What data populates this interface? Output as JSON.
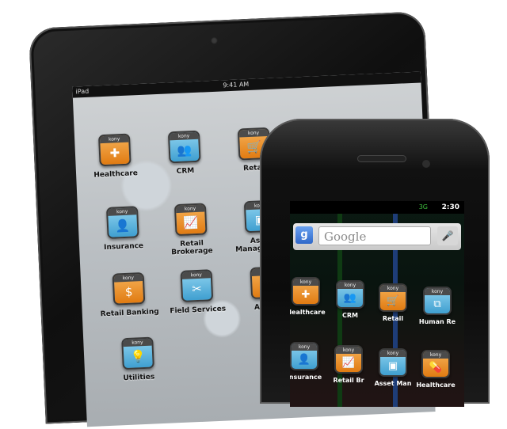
{
  "tablet": {
    "status": {
      "carrier": "iPad",
      "time": "9:41 AM"
    },
    "apps": [
      {
        "label": "Healthcare",
        "color": "orange",
        "icon": "shield-plus-icon",
        "glyph": "✚"
      },
      {
        "label": "CRM",
        "color": "blue",
        "icon": "people-icon",
        "glyph": "👥"
      },
      {
        "label": "Retail",
        "color": "orange",
        "icon": "cart-icon",
        "glyph": "🛒"
      },
      {
        "label": "Insurance",
        "color": "blue",
        "icon": "person-icon",
        "glyph": "👤"
      },
      {
        "label": "Retail Brokerage",
        "color": "orange",
        "icon": "chart-icon",
        "glyph": "📈"
      },
      {
        "label": "Asset Management",
        "color": "blue",
        "icon": "asset-icon",
        "glyph": "▣"
      },
      {
        "label": "Retail Banking",
        "color": "orange",
        "icon": "money-icon",
        "glyph": "$"
      },
      {
        "label": "Field Services",
        "color": "blue",
        "icon": "tools-icon",
        "glyph": "✂"
      },
      {
        "label": "Airline",
        "color": "orange",
        "icon": "plane-icon",
        "glyph": "✈"
      },
      {
        "label": "Utilities",
        "color": "blue",
        "icon": "bulb-icon",
        "glyph": "💡"
      }
    ]
  },
  "phone": {
    "status": {
      "time": "2:30",
      "indicator": "3G"
    },
    "search": {
      "engine_glyph": "g",
      "placeholder": "Google",
      "mic_glyph": "🎤"
    },
    "apps": [
      {
        "label": "Healthcare",
        "color": "orange",
        "icon": "shield-plus-icon",
        "glyph": "✚"
      },
      {
        "label": "CRM",
        "color": "blue",
        "icon": "people-icon",
        "glyph": "👥"
      },
      {
        "label": "Retail",
        "color": "orange",
        "icon": "cart-icon",
        "glyph": "🛒"
      },
      {
        "label": "Human Re",
        "color": "blue",
        "icon": "org-chart-icon",
        "glyph": "⧉"
      },
      {
        "label": "Insurance",
        "color": "blue",
        "icon": "person-icon",
        "glyph": "👤"
      },
      {
        "label": "Retail Br",
        "color": "orange",
        "icon": "chart-icon",
        "glyph": "📈"
      },
      {
        "label": "Asset Man",
        "color": "blue",
        "icon": "asset-icon",
        "glyph": "▣"
      },
      {
        "label": "Healthcare",
        "color": "orange",
        "icon": "pills-icon",
        "glyph": "💊"
      }
    ]
  },
  "colors": {
    "orange": "#e88b23",
    "blue": "#4aa9d8",
    "google_blue": "#3a74d6"
  }
}
